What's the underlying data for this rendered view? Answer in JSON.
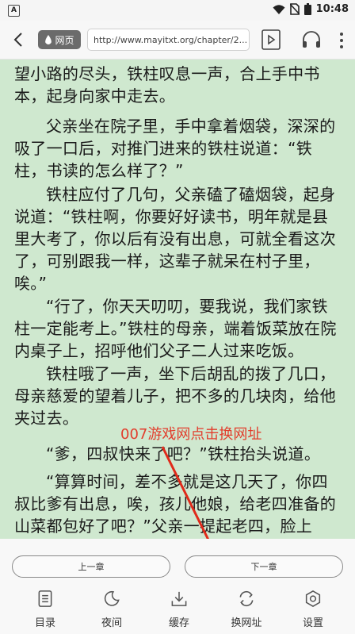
{
  "status_bar": {
    "app_badge": "A",
    "time": "10:48"
  },
  "toolbar": {
    "mode_label": "网页",
    "url": "http://www.mayitxt.org/chapter/2..."
  },
  "content": {
    "paragraphs": [
      "望小路的尽头，铁柱叹息一声，合上手中书本，起身向家中走去。",
      "父亲坐在院子里，手中拿着烟袋，深深的吸了一口后，对推门进来的铁柱说道：“铁柱，书读的怎么样了？”",
      "铁柱应付了几句，父亲磕了磕烟袋，起身说道：“铁柱啊，你要好好读书，明年就是县里大考了，你以后有没有出息，可就全看这次了，可别跟我一样，这辈子就呆在村子里，唉。”",
      "“行了，你天天叨叨，要我说，我们家铁柱一定能考上。”铁柱的母亲，端着饭菜放在院内桌子上，招呼他们父子二人过来吃饭。",
      "铁柱哦了一声，坐下后胡乱的拨了几口，母亲慈爱的望着儿子，把不多的几块肉，给他夹过去。",
      "“爹，四叔快来了吧？”铁柱抬头说道。",
      "“算算时间，差不多就是这几天了，你四叔比爹有出息，唉，孩儿他娘，给老四准备的山菜都包好了吧？”父亲一提起老四，脸上"
    ],
    "overlay_text": "007游戏网点击换网址"
  },
  "chapter_nav": {
    "prev_label": "上一章",
    "next_label": "下一章"
  },
  "bottom_nav": [
    {
      "label": "目录",
      "icon": "toc-icon"
    },
    {
      "label": "夜间",
      "icon": "moon-icon"
    },
    {
      "label": "缓存",
      "icon": "download-icon"
    },
    {
      "label": "换网址",
      "icon": "switch-icon"
    },
    {
      "label": "设置",
      "icon": "gear-icon"
    }
  ],
  "colors": {
    "reading_background": "#cfe8cf",
    "overlay_text": "#e23d2c",
    "arrow": "#e02a1a"
  }
}
